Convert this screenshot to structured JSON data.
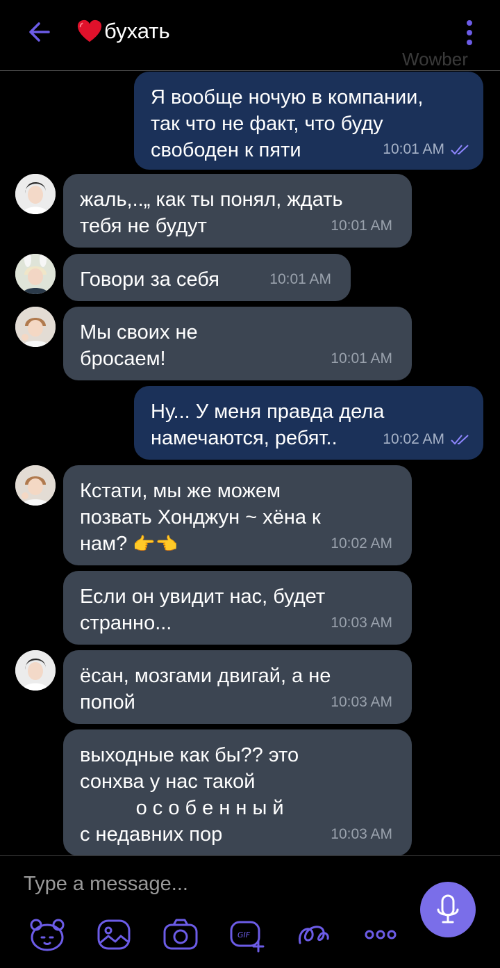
{
  "header": {
    "title": "бухать",
    "watermark": "Wowber",
    "accent": "#6c5ce7"
  },
  "messages": [
    {
      "dir": "out",
      "text": "Я вообще ночую в компании,\nтак что не факт, что буду\nсвободен к пяти",
      "time": "10:01 AM"
    },
    {
      "dir": "in",
      "text": "жаль,..„ как ты понял, ждать\nтебя не будут",
      "time": "10:01 AM"
    },
    {
      "dir": "in",
      "text": "Говори за себя",
      "time": "10:01 AM"
    },
    {
      "dir": "in",
      "text": "Мы своих не\nбросаем!",
      "time": "10:01 AM"
    },
    {
      "dir": "out",
      "text": "Ну... У меня правда дела\nнамечаются, ребят..",
      "time": "10:02 AM"
    },
    {
      "dir": "in",
      "text": "Кстати, мы же можем\nпозвать Хонджун ~ хёна к\nнам?",
      "time": "10:02 AM",
      "emoji": "👉👈"
    },
    {
      "dir": "in",
      "text": "Если он увидит нас, будет\nстранно...",
      "time": "10:03 AM"
    },
    {
      "dir": "in",
      "text": "ёсан, мозгами двигай, а не\nпопой",
      "time": "10:03 AM"
    },
    {
      "dir": "in",
      "text": "выходные как бы?? это\nсонхва у нас такой\n          о с о б е н н ы й\nс недавних пор",
      "time": "10:03 AM"
    }
  ],
  "composer": {
    "placeholder": "Type a message...",
    "tools": [
      "sticker-bear-icon",
      "image-sticker-icon",
      "camera-icon",
      "gif-icon",
      "doodle-icon",
      "more-icon"
    ],
    "mic_color": "#7a6ee9"
  },
  "colors": {
    "bg": "#000000",
    "incoming": "#3c4552",
    "outgoing": "#1b3159",
    "ticks": "#8f86ff"
  }
}
